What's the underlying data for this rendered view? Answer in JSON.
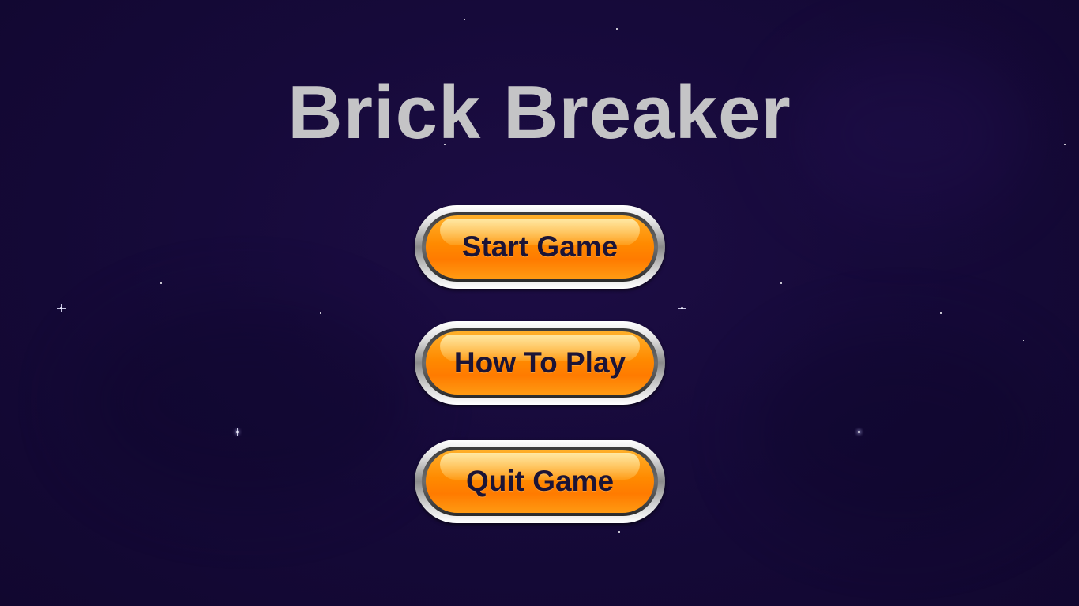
{
  "title": "Brick Breaker",
  "menu": {
    "start_label": "Start Game",
    "howto_label": "How To Play",
    "quit_label": "Quit Game"
  },
  "colors": {
    "background": "#160a3a",
    "title": "#c4c4c6",
    "button_face": "#ff8a00",
    "button_text": "#1c1436"
  }
}
